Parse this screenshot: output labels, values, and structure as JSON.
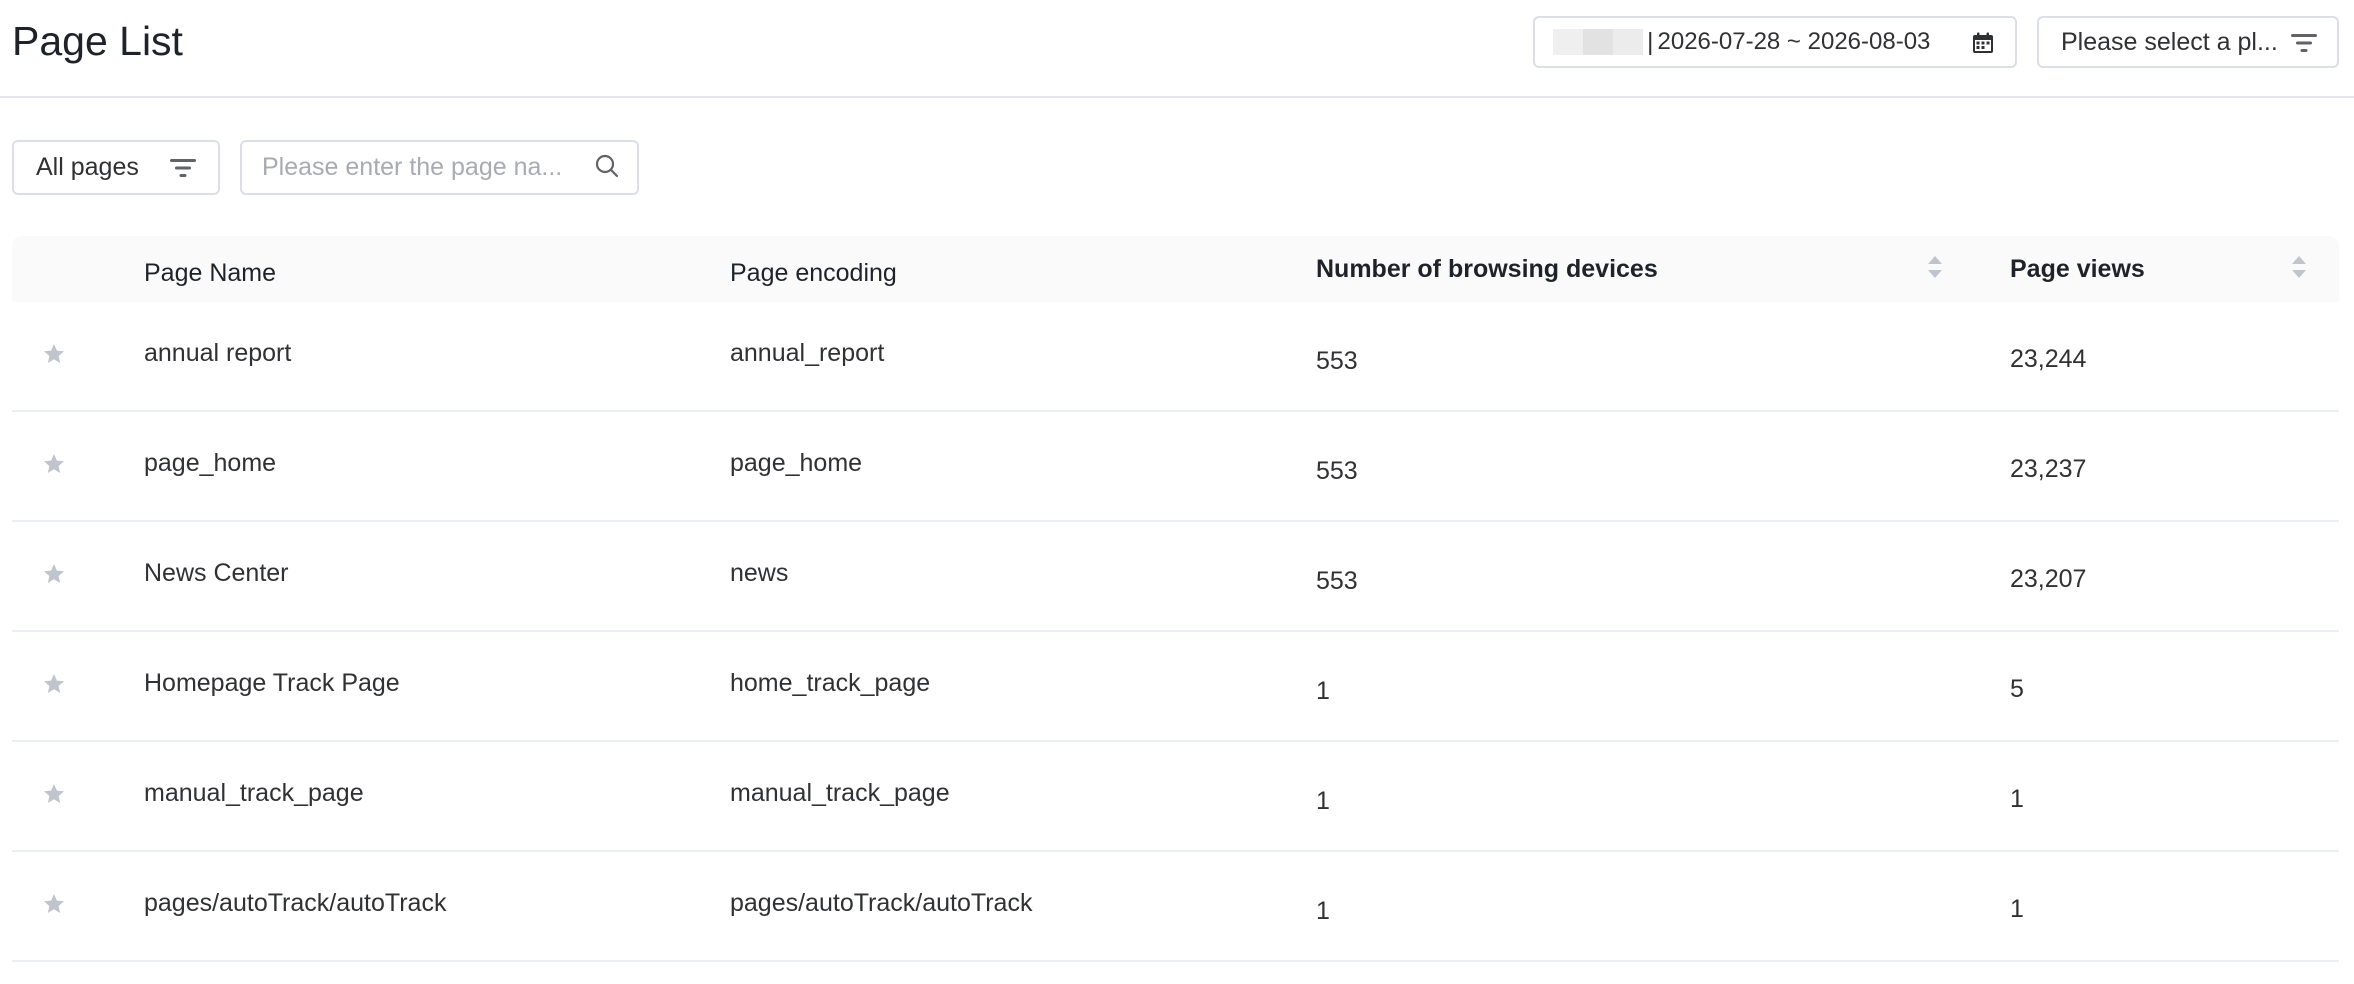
{
  "header": {
    "title": "Page List",
    "date_range": "2026-07-28 ~ 2026-08-03",
    "date_separator": "|",
    "platform_placeholder": "Please select a pl..."
  },
  "filters": {
    "pages_filter_label": "All pages",
    "search_placeholder": "Please enter the page na..."
  },
  "table": {
    "columns": {
      "name": "Page Name",
      "encoding": "Page encoding",
      "devices": "Number of browsing devices",
      "views": "Page views"
    },
    "rows": [
      {
        "name": "annual report",
        "encoding": "annual_report",
        "devices": "553",
        "views": "23,244"
      },
      {
        "name": "page_home",
        "encoding": "page_home",
        "devices": "553",
        "views": "23,237"
      },
      {
        "name": "News Center",
        "encoding": "news",
        "devices": "553",
        "views": "23,207"
      },
      {
        "name": "Homepage Track Page",
        "encoding": "home_track_page",
        "devices": "1",
        "views": "5"
      },
      {
        "name": "manual_track_page",
        "encoding": "manual_track_page",
        "devices": "1",
        "views": "1"
      },
      {
        "name": "pages/autoTrack/autoTrack",
        "encoding": "pages/autoTrack/autoTrack",
        "devices": "1",
        "views": "1"
      }
    ]
  },
  "icons": {
    "calendar": "calendar-icon",
    "filter": "filter-icon",
    "search": "search-icon",
    "star": "star-icon",
    "sort": "sort-icon"
  },
  "colors": {
    "border": "#dcdfe6",
    "row_divider": "#ebeef5",
    "header_bg": "#fafafa",
    "star": "#c0c4cc",
    "text": "#303133"
  }
}
